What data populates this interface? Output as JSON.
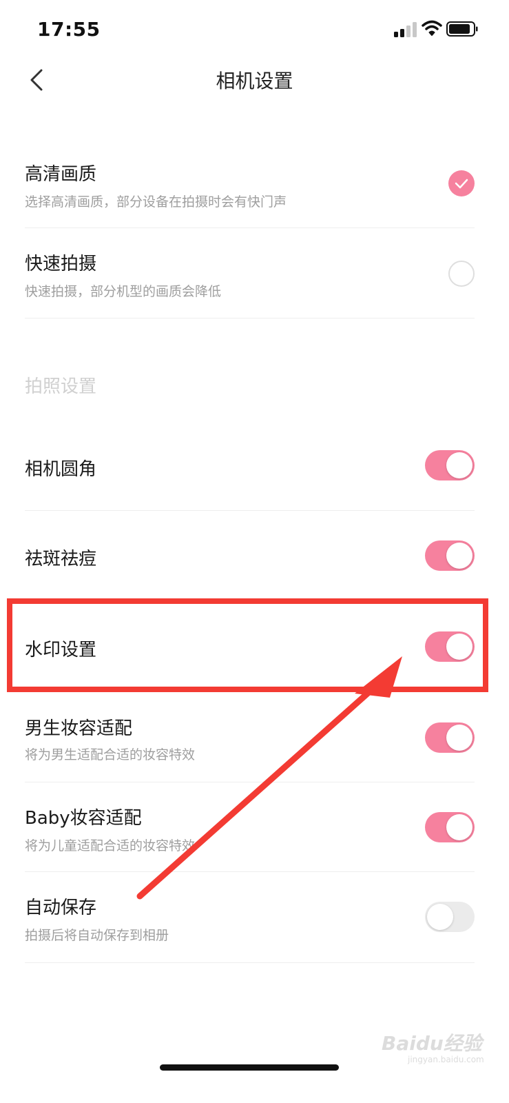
{
  "status_bar": {
    "time": "17:55"
  },
  "header": {
    "title": "相机设置",
    "back_icon": "chevron-left-icon"
  },
  "quality_options": [
    {
      "title": "高清画质",
      "subtitle": "选择高清画质，部分设备在拍摄时会有快门声",
      "selected": true
    },
    {
      "title": "快速拍摄",
      "subtitle": "快速拍摄，部分机型的画质会降低",
      "selected": false
    }
  ],
  "section": {
    "title": "拍照设置"
  },
  "photo_settings": [
    {
      "title": "相机圆角",
      "subtitle": "",
      "enabled": true
    },
    {
      "title": "祛斑祛痘",
      "subtitle": "",
      "enabled": true
    },
    {
      "title": "水印设置",
      "subtitle": "",
      "enabled": true
    },
    {
      "title": "男生妆容适配",
      "subtitle": "将为男生适配合适的妆容特效",
      "enabled": true
    },
    {
      "title": "Baby妆容适配",
      "subtitle": "将为儿童适配合适的妆容特效",
      "enabled": true
    },
    {
      "title": "自动保存",
      "subtitle": "拍摄后将自动保存到相册",
      "enabled": false
    }
  ],
  "watermark": {
    "text": "Baidu经验",
    "sub": "jingyan.baidu.com"
  },
  "colors": {
    "accent": "#f6819e",
    "annotation": "#f33b33"
  }
}
